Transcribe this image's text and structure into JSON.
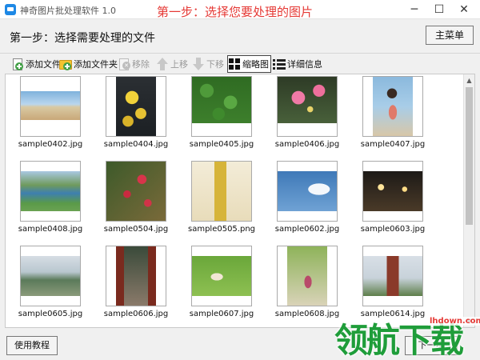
{
  "window": {
    "title": "神奇图片批处理软件 1.0",
    "banner": "第一步：选择您要处理的图片",
    "controls": {
      "minimize": "─",
      "maximize": "☐",
      "close": "✕"
    }
  },
  "step": {
    "title": "第一步：选择需要处理的文件",
    "menu_label": "主菜单"
  },
  "toolbar": {
    "add_file": "添加文件",
    "add_folder": "添加文件夹",
    "remove": "移除",
    "move_up": "上移",
    "move_down": "下移",
    "thumbnail": "缩略图",
    "details": "详细信息"
  },
  "files": [
    {
      "name": "sample0402.jpg",
      "photo": "beach"
    },
    {
      "name": "sample0404.jpg",
      "photo": "ginkgo"
    },
    {
      "name": "sample0405.jpg",
      "photo": "clover"
    },
    {
      "name": "sample0406.jpg",
      "photo": "blossom"
    },
    {
      "name": "sample0407.jpg",
      "photo": "girl-beach"
    },
    {
      "name": "sample0408.jpg",
      "photo": "lake"
    },
    {
      "name": "sample0504.jpg",
      "photo": "red-berries"
    },
    {
      "name": "sample0505.png",
      "photo": "bottles"
    },
    {
      "name": "sample0602.jpg",
      "photo": "sky"
    },
    {
      "name": "sample0603.jpg",
      "photo": "night-lights"
    },
    {
      "name": "sample0605.jpg",
      "photo": "shore"
    },
    {
      "name": "sample0606.jpg",
      "photo": "alley"
    },
    {
      "name": "sample0607.jpg",
      "photo": "girl-grass"
    },
    {
      "name": "sample0608.jpg",
      "photo": "girl-willow"
    },
    {
      "name": "sample0614.jpg",
      "photo": "pagoda"
    }
  ],
  "bottom": {
    "help_label": "使用教程",
    "next_label": "下一步"
  },
  "watermark": {
    "chars": "领航下载",
    "url": "lhdown.com"
  },
  "colors": {
    "banner": "#e53935",
    "watermark": "#1f9d3a"
  }
}
